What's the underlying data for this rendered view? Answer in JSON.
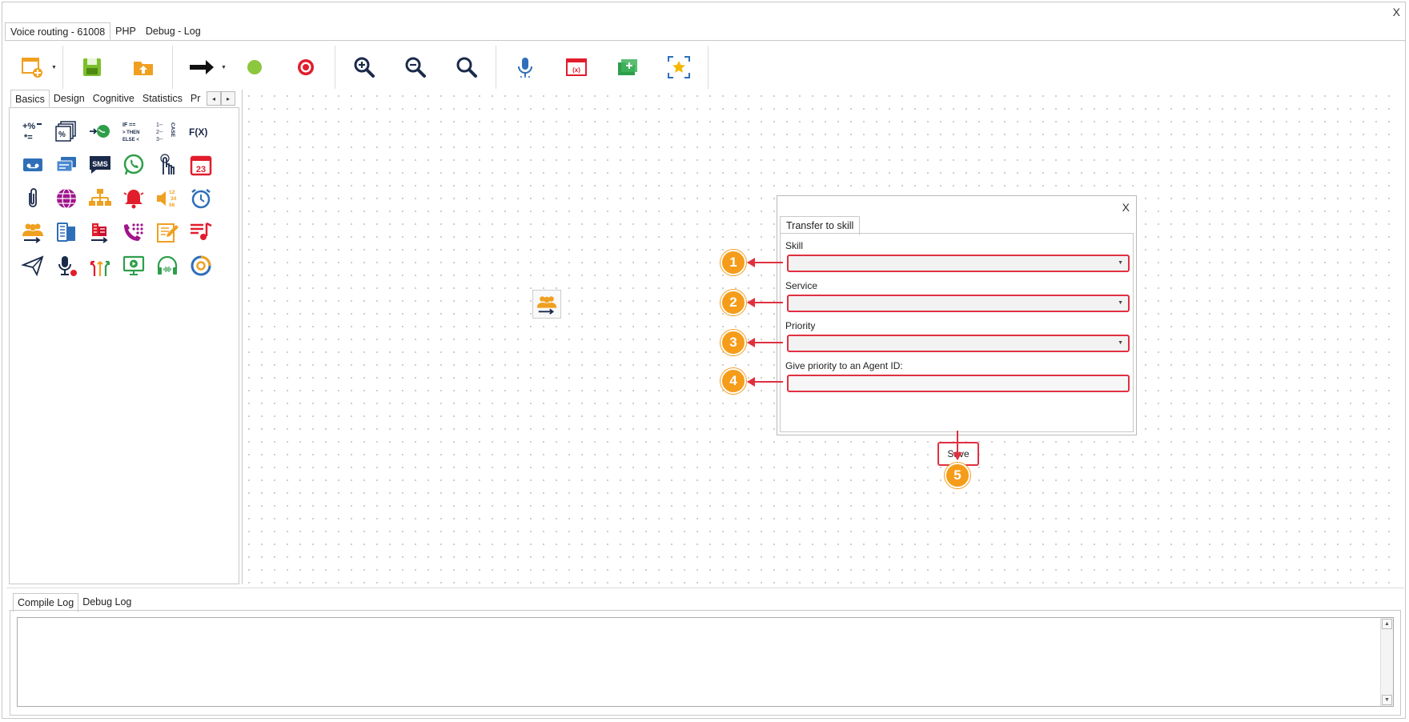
{
  "window": {
    "close_label": "X"
  },
  "top_tabs": [
    {
      "label": "Voice routing - 61008"
    },
    {
      "label": "PHP"
    },
    {
      "label": "Debug - Log"
    }
  ],
  "toolbar": {
    "buttons": [
      {
        "icon": "new-window-icon"
      },
      {
        "icon": "save-icon"
      },
      {
        "icon": "upload-icon"
      },
      {
        "icon": "arrow-right-icon"
      },
      {
        "icon": "green-circle-icon"
      },
      {
        "icon": "record-icon"
      },
      {
        "icon": "zoom-in-icon"
      },
      {
        "icon": "zoom-out-icon"
      },
      {
        "icon": "zoom-fit-icon"
      },
      {
        "icon": "microphone-icon"
      },
      {
        "icon": "variables-icon"
      },
      {
        "icon": "add-folder-icon"
      },
      {
        "icon": "focus-star-icon"
      }
    ]
  },
  "palette": {
    "tabs": [
      {
        "label": "Basics"
      },
      {
        "label": "Design"
      },
      {
        "label": "Cognitive"
      },
      {
        "label": "Statistics"
      },
      {
        "label": "Pr"
      }
    ],
    "arrows": {
      "left": "◂",
      "right": "▸"
    },
    "text_icons": {
      "fx": "F(X)",
      "sms": "SMS",
      "calendar_day": "23",
      "case": "CASE",
      "if_then_else": "IF == > THEN ELSE <"
    }
  },
  "dialog": {
    "close_label": "X",
    "tab_label": "Transfer to skill",
    "fields": [
      {
        "label": "Skill",
        "value": "",
        "type": "select"
      },
      {
        "label": "Service",
        "value": "",
        "type": "select"
      },
      {
        "label": "Priority",
        "value": "",
        "type": "select"
      },
      {
        "label": "Give priority to an Agent ID:",
        "value": "",
        "type": "text"
      }
    ],
    "save_label": "Save"
  },
  "callouts": [
    "1",
    "2",
    "3",
    "4",
    "5"
  ],
  "log": {
    "tabs": [
      {
        "label": "Compile Log"
      },
      {
        "label": "Debug Log"
      }
    ],
    "content": ""
  },
  "colors": {
    "highlight": "#e03040",
    "callout": "#f59c1a"
  }
}
